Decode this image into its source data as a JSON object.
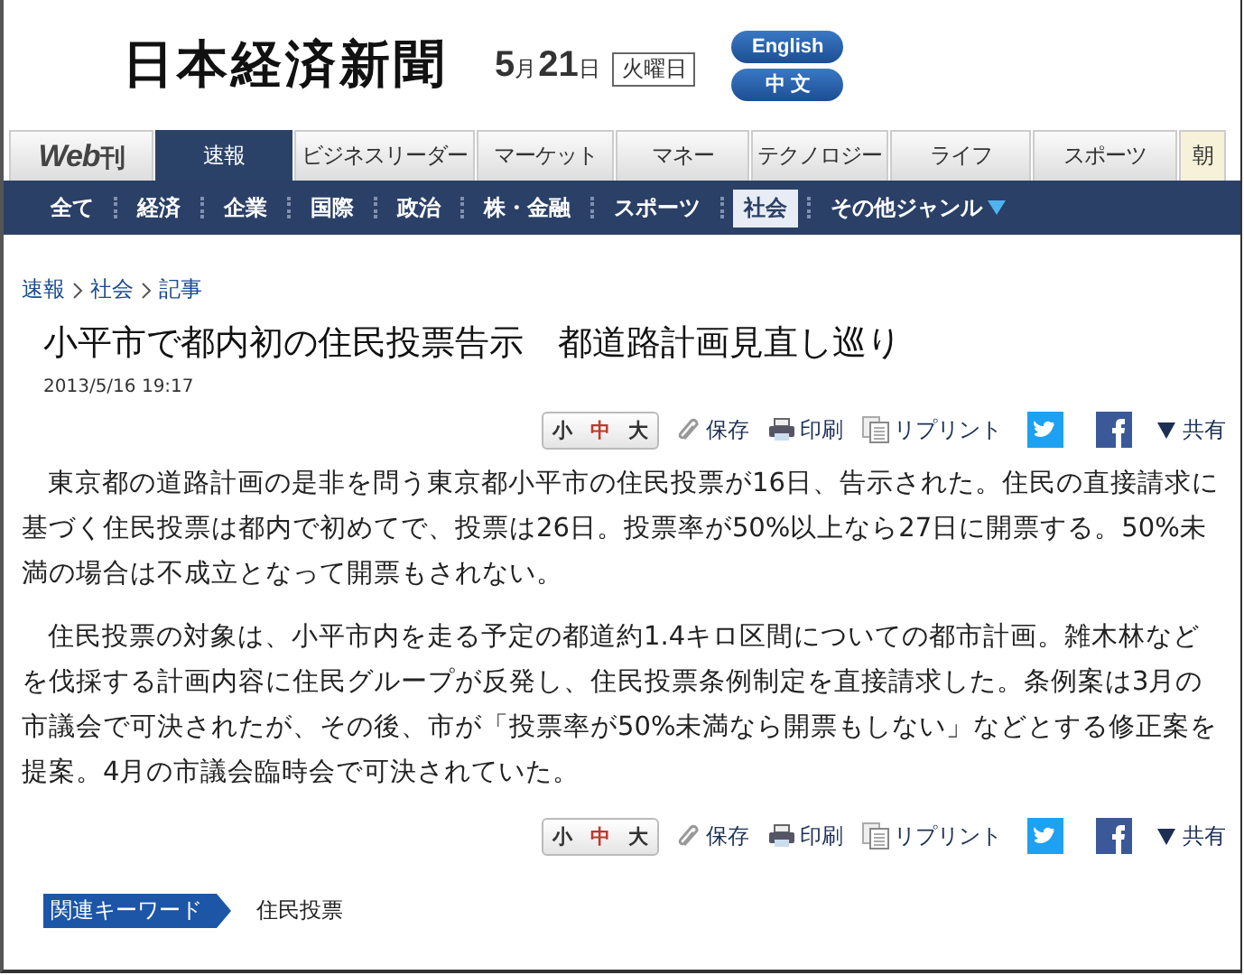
{
  "header": {
    "logo": "日本経済新聞",
    "date": {
      "month": "5",
      "month_unit": "月",
      "day": "21",
      "day_unit": "日",
      "weekday": "火曜日"
    },
    "language_buttons": [
      "English",
      "中 文"
    ]
  },
  "tabs": [
    {
      "label": "Web",
      "label_suffix": "刊",
      "kind": "brand",
      "selected": false
    },
    {
      "label": "速報",
      "kind": "tab",
      "selected": true
    },
    {
      "label": "ビジネスリーダー",
      "kind": "tab",
      "selected": false
    },
    {
      "label": "マーケット",
      "kind": "tab",
      "selected": false
    },
    {
      "label": "マネー",
      "kind": "tab",
      "selected": false
    },
    {
      "label": "テクノロジー",
      "kind": "tab",
      "selected": false
    },
    {
      "label": "ライフ",
      "kind": "tab",
      "selected": false
    },
    {
      "label": "スポーツ",
      "kind": "tab",
      "selected": false
    },
    {
      "label": "朝",
      "kind": "cut",
      "selected": false
    }
  ],
  "subnav": [
    {
      "label": "全て",
      "selected": false,
      "dropdown": false
    },
    {
      "label": "経済",
      "selected": false,
      "dropdown": false
    },
    {
      "label": "企業",
      "selected": false,
      "dropdown": false
    },
    {
      "label": "国際",
      "selected": false,
      "dropdown": false
    },
    {
      "label": "政治",
      "selected": false,
      "dropdown": false
    },
    {
      "label": "株・金融",
      "selected": false,
      "dropdown": false
    },
    {
      "label": "スポーツ",
      "selected": false,
      "dropdown": false
    },
    {
      "label": "社会",
      "selected": true,
      "dropdown": false
    },
    {
      "label": "その他ジャンル",
      "selected": false,
      "dropdown": true
    }
  ],
  "breadcrumb": [
    "速報",
    "社会",
    "記事"
  ],
  "article": {
    "title": "小平市で都内初の住民投票告示　都道路計画見直し巡り",
    "timestamp": "2013/5/16 19:17",
    "paragraphs": [
      "東京都の道路計画の是非を問う東京都小平市の住民投票が16日、告示された。住民の直接請求に基づく住民投票は都内で初めてで、投票は26日。投票率が50%以上なら27日に開票する。50%未満の場合は不成立となって開票もされない。",
      "住民投票の対象は、小平市内を走る予定の都道約1.4キロ区間についての都市計画。雑木林などを伐採する計画内容に住民グループが反発し、住民投票条例制定を直接請求した。条例案は3月の市議会で可決されたが、その後、市が「投票率が50%未満なら開票もしない」などとする修正案を提案。4月の市議会臨時会で可決されていた。"
    ]
  },
  "toolbars": [
    {
      "font_sizes": [
        {
          "label": "小",
          "selected": false
        },
        {
          "label": "中",
          "selected": true
        },
        {
          "label": "大",
          "selected": false
        }
      ],
      "save": "保存",
      "print": "印刷",
      "reprint": "リプリント",
      "share": "共有"
    },
    {
      "font_sizes": [
        {
          "label": "小",
          "selected": false
        },
        {
          "label": "中",
          "selected": true
        },
        {
          "label": "大",
          "selected": false
        }
      ],
      "save": "保存",
      "print": "印刷",
      "reprint": "リプリント",
      "share": "共有"
    }
  ],
  "keywords": {
    "label": "関連キーワード",
    "items": [
      "住民投票"
    ]
  }
}
